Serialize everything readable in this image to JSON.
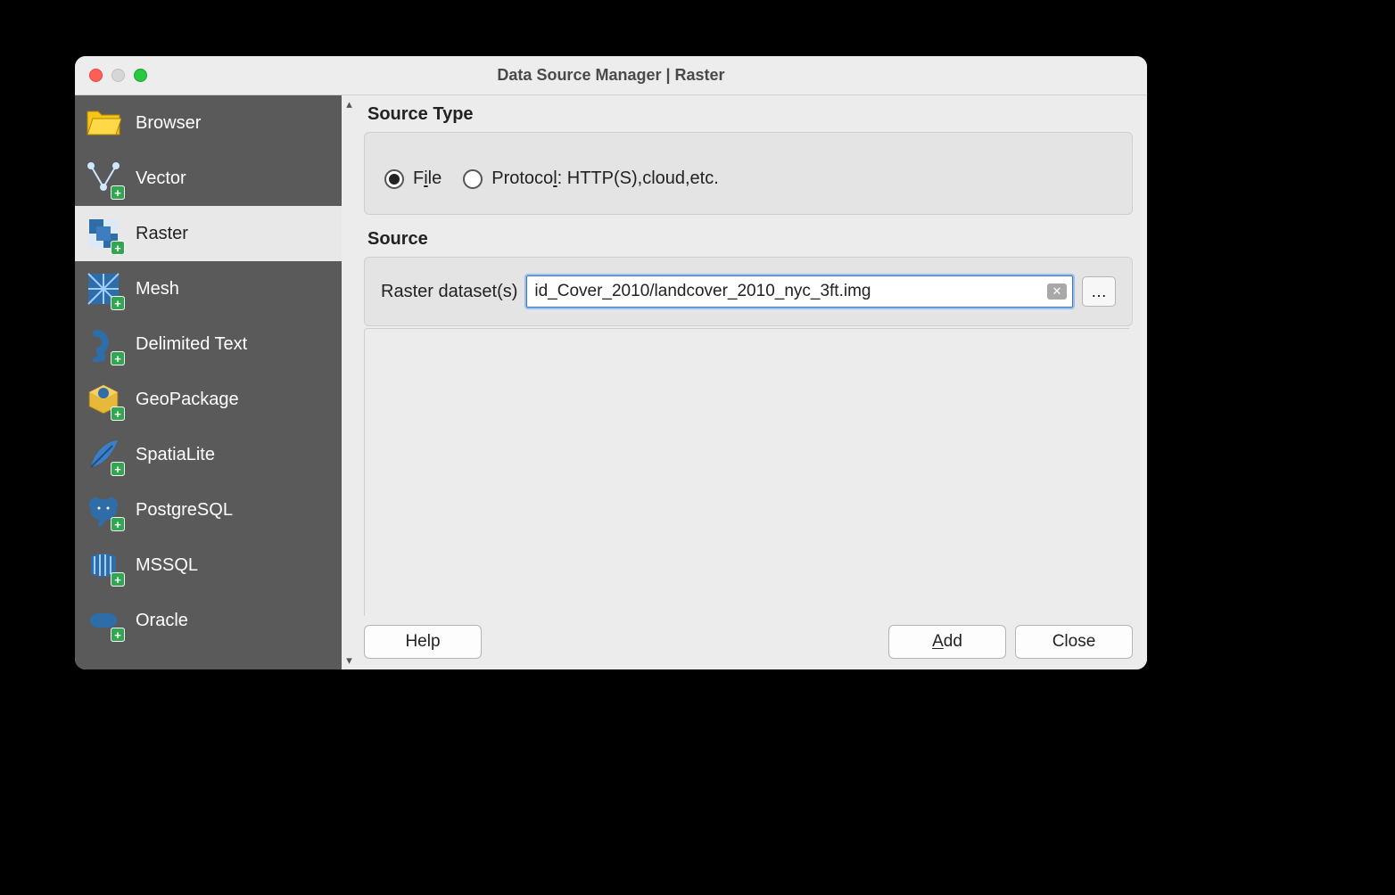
{
  "window": {
    "title": "Data Source Manager | Raster"
  },
  "sidebar": {
    "items": [
      {
        "label": "Browser",
        "icon": "folder",
        "plus": false,
        "selected": false
      },
      {
        "label": "Vector",
        "icon": "vector",
        "plus": true,
        "selected": false
      },
      {
        "label": "Raster",
        "icon": "raster",
        "plus": true,
        "selected": true
      },
      {
        "label": "Mesh",
        "icon": "mesh",
        "plus": true,
        "selected": false
      },
      {
        "label": "Delimited Text",
        "icon": "comma",
        "plus": true,
        "selected": false
      },
      {
        "label": "GeoPackage",
        "icon": "geopackage",
        "plus": true,
        "selected": false
      },
      {
        "label": "SpatiaLite",
        "icon": "feather",
        "plus": true,
        "selected": false
      },
      {
        "label": "PostgreSQL",
        "icon": "elephant",
        "plus": true,
        "selected": false
      },
      {
        "label": "MSSQL",
        "icon": "mssql",
        "plus": true,
        "selected": false
      },
      {
        "label": "Oracle",
        "icon": "oracle",
        "plus": true,
        "selected": false
      }
    ]
  },
  "main": {
    "source_type": {
      "header": "Source Type",
      "file_label_pre": "F",
      "file_label_u": "i",
      "file_label_post": "le",
      "protocol_label_pre": "Protoco",
      "protocol_label_u": "l",
      "protocol_label_post": ": HTTP(S),cloud,etc.",
      "selected": "file"
    },
    "source": {
      "header": "Source",
      "field_label": "Raster dataset(s)",
      "value": "id_Cover_2010/landcover_2010_nyc_3ft.img",
      "browse_label": "…"
    }
  },
  "buttons": {
    "help": "Help",
    "add_pre": "",
    "add_u": "A",
    "add_post": "dd",
    "close": "Close"
  }
}
